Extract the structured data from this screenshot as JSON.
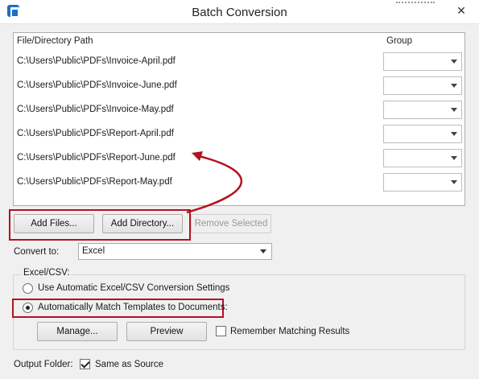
{
  "window": {
    "title": "Batch Conversion",
    "close_label": "✕"
  },
  "file_list": {
    "columns": [
      "File/Directory Path",
      "Group"
    ],
    "rows": [
      {
        "path": "C:\\Users\\Public\\PDFs\\Invoice-April.pdf",
        "group": ""
      },
      {
        "path": "C:\\Users\\Public\\PDFs\\Invoice-June.pdf",
        "group": ""
      },
      {
        "path": "C:\\Users\\Public\\PDFs\\Invoice-May.pdf",
        "group": ""
      },
      {
        "path": "C:\\Users\\Public\\PDFs\\Report-April.pdf",
        "group": ""
      },
      {
        "path": "C:\\Users\\Public\\PDFs\\Report-June.pdf",
        "group": ""
      },
      {
        "path": "C:\\Users\\Public\\PDFs\\Report-May.pdf",
        "group": ""
      }
    ]
  },
  "buttons": {
    "add_files": "Add Files...",
    "add_directory": "Add Directory...",
    "remove_selected": "Remove Selected"
  },
  "convert_to": {
    "label": "Convert to:",
    "value": "Excel"
  },
  "excel_csv": {
    "title": "Excel/CSV:",
    "option_auto_settings": "Use Automatic Excel/CSV Conversion Settings",
    "option_match_templates": "Automatically Match Templates to Documents:",
    "selected_option": "option_match_templates",
    "manage": "Manage...",
    "preview": "Preview",
    "remember_label": "Remember Matching Results",
    "remember_checked": false
  },
  "output": {
    "label": "Output Folder:",
    "same_as_source_label": "Same as Source",
    "same_as_source_checked": true
  },
  "colors": {
    "annotation": "#b3121f"
  }
}
